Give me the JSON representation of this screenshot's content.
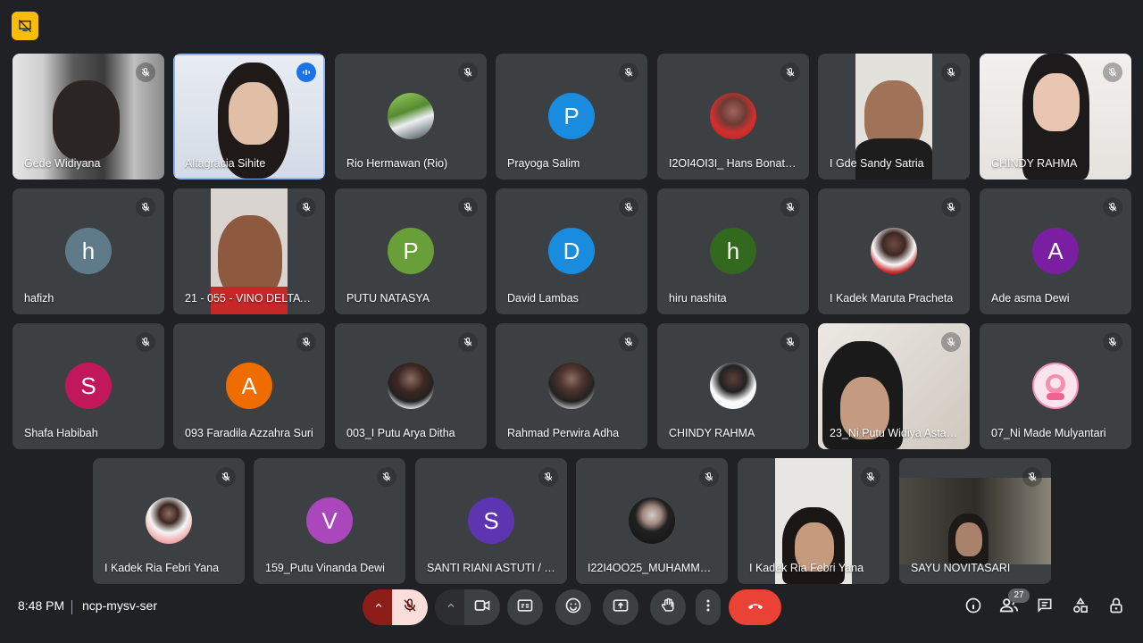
{
  "meeting": {
    "time": "8:48 PM",
    "code": "ncp-mysv-ser",
    "participant_count": "27"
  },
  "participants": [
    {
      "name": "Gede Widiyana",
      "kind": "video",
      "muted": true
    },
    {
      "name": "Altagracia Sihite",
      "kind": "video",
      "speaking": true
    },
    {
      "name": "Rio Hermawan (Rio)",
      "kind": "photo",
      "muted": true
    },
    {
      "name": "Prayoga Salim",
      "kind": "initial",
      "initial": "P",
      "color": "#1a8ce0",
      "muted": true
    },
    {
      "name": "I2OI4OI3I_ Hans Bonatu…",
      "kind": "photo",
      "muted": true
    },
    {
      "name": "I Gde Sandy Satria",
      "kind": "video",
      "muted": true
    },
    {
      "name": "CHINDY RAHMA",
      "kind": "video",
      "muted": true
    },
    {
      "name": "hafizh",
      "kind": "initial",
      "initial": "h",
      "color": "#5f7b8a",
      "muted": true
    },
    {
      "name": "21 - 055 - VINO DELTAY…",
      "kind": "video",
      "muted": true
    },
    {
      "name": "PUTU NATASYA",
      "kind": "initial",
      "initial": "P",
      "color": "#689f38",
      "muted": true
    },
    {
      "name": "David Lambas",
      "kind": "initial",
      "initial": "D",
      "color": "#1a8ce0",
      "muted": true
    },
    {
      "name": "hiru nashita",
      "kind": "initial",
      "initial": "h",
      "color": "#33691e",
      "muted": true
    },
    {
      "name": "I Kadek Maruta Pracheta",
      "kind": "photo",
      "muted": true
    },
    {
      "name": "Ade asma Dewi",
      "kind": "initial",
      "initial": "A",
      "color": "#7b1fa2",
      "muted": true
    },
    {
      "name": "Shafa Habibah",
      "kind": "initial",
      "initial": "S",
      "color": "#c2185b",
      "muted": true
    },
    {
      "name": "093 Faradila Azzahra Suri",
      "kind": "initial",
      "initial": "A",
      "color": "#ef6c00",
      "muted": true
    },
    {
      "name": "003_I Putu Arya Ditha",
      "kind": "photo",
      "muted": true
    },
    {
      "name": "Rahmad Perwira Adha",
      "kind": "photo",
      "muted": true
    },
    {
      "name": "CHINDY RAHMA",
      "kind": "photo",
      "muted": true
    },
    {
      "name": "23_Ni Putu Widiya Astari…",
      "kind": "video",
      "muted": true
    },
    {
      "name": "07_Ni Made Mulyantari",
      "kind": "photo",
      "muted": true
    },
    {
      "name": "I Kadek Ria Febri Yana",
      "kind": "photo",
      "muted": true
    },
    {
      "name": "159_Putu Vinanda Dewi",
      "kind": "initial",
      "initial": "V",
      "color": "#ab47bc",
      "muted": true
    },
    {
      "name": "SANTI RIANI ASTUTI / I2…",
      "kind": "initial",
      "initial": "S",
      "color": "#5e35b1",
      "muted": true
    },
    {
      "name": "I22I4OO25_MUHAMMA…",
      "kind": "photo",
      "muted": true
    },
    {
      "name": "I Kadek Ria Febri Yana",
      "kind": "video",
      "muted": true
    },
    {
      "name": "SAYU NOVITASARI",
      "kind": "video",
      "muted": true
    }
  ],
  "controls": {
    "icons": [
      "raise-arrow-icon",
      "mic-off-icon",
      "more-arrow-icon",
      "camera-icon",
      "captions-icon",
      "emoji-icon",
      "present-icon",
      "hand-icon",
      "more-vert-icon",
      "leave-call-icon"
    ],
    "right_icons": [
      "info-icon",
      "people-icon",
      "chat-icon",
      "activities-icon",
      "host-controls-icon"
    ]
  },
  "colors": {
    "accent": "#8ab4f8",
    "leave": "#ea4335",
    "tile": "#3c4043",
    "background": "#202124"
  }
}
